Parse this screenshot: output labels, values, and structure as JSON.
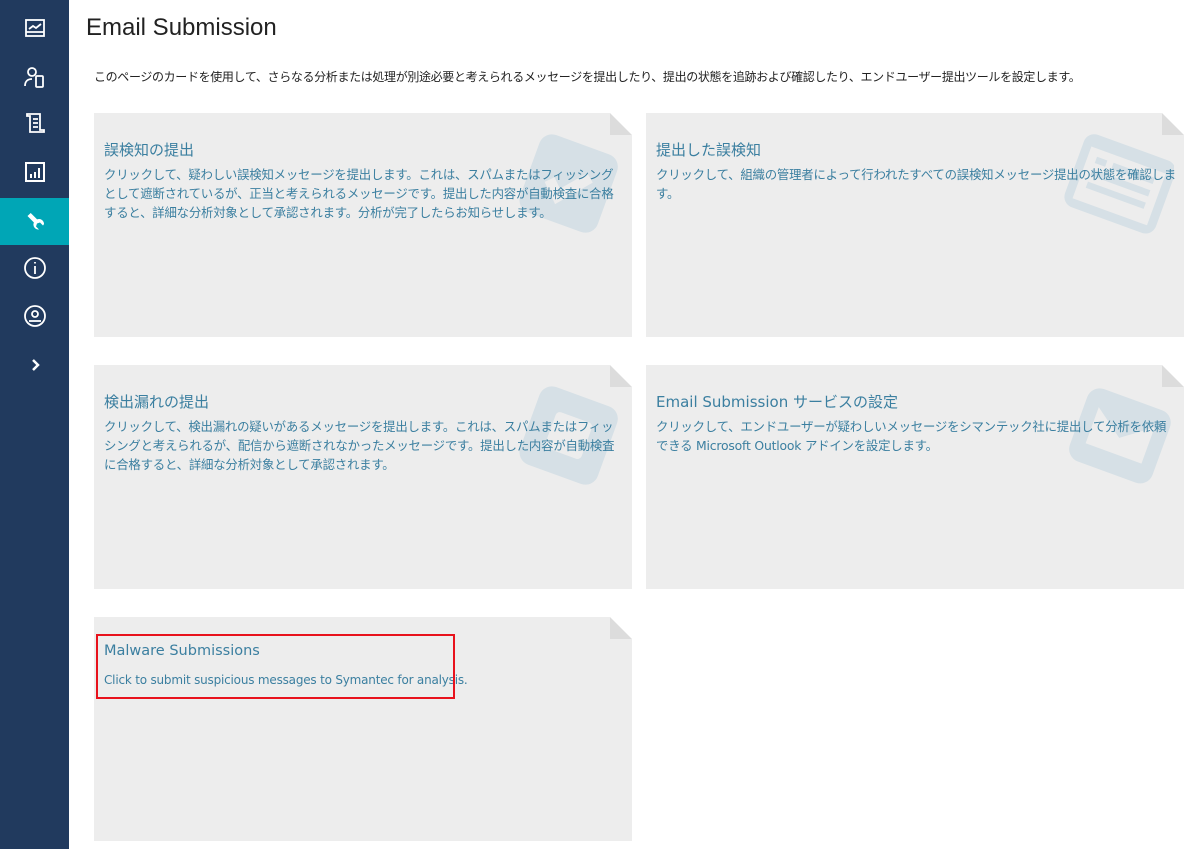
{
  "page": {
    "title": "Email Submission",
    "intro": "このページのカードを使用して、さらなる分析または処理が別途必要と考えられるメッセージを提出したり、提出の状態を追跡および確認したり、エンドユーザー提出ツールを設定します。"
  },
  "sidebar": {
    "items": [
      {
        "icon": "dashboard-icon"
      },
      {
        "icon": "users-devices-icon"
      },
      {
        "icon": "policy-scroll-icon"
      },
      {
        "icon": "reports-chart-icon"
      },
      {
        "icon": "wrench-tools-icon",
        "active": true
      },
      {
        "icon": "info-icon"
      },
      {
        "icon": "user-account-icon"
      },
      {
        "icon": "expand-chevron-icon"
      }
    ],
    "active_color": "#00a6b6",
    "bg_color": "#213a5e"
  },
  "cards": [
    {
      "title": "誤検知の提出",
      "description": "クリックして、疑わしい誤検知メッセージを提出します。これは、スパムまたはフィッシングとして遮断されているが、正当と考えられるメッセージです。提出した内容が自動検査に合格すると、詳細な分析対象として承認されます。分析が完了したらお知らせします。",
      "icon": "check-document-icon"
    },
    {
      "title": "提出した誤検知",
      "description": "クリックして、組織の管理者によって行われたすべての誤検知メッセージ提出の状態を確認します。",
      "icon": "list-document-icon"
    },
    {
      "title": "検出漏れの提出",
      "description": "クリックして、検出漏れの疑いがあるメッセージを提出します。これは、スパムまたはフィッシングと考えられるが、配信から遮断されなかったメッセージです。提出した内容が自動検査に合格すると、詳細な分析対象として承認されます。",
      "icon": "missed-document-icon"
    },
    {
      "title": "Email Submission サービスの設定",
      "description": "クリックして、エンドユーザーが疑わしいメッセージをシマンテック社に提出して分析を依頼できる Microsoft Outlook アドインを設定します。",
      "icon": "envelope-icon"
    },
    {
      "title": "Malware Submissions",
      "description": "Click to submit suspicious messages to Symantec for analysis.",
      "icon": "none",
      "highlighted": true
    }
  ]
}
